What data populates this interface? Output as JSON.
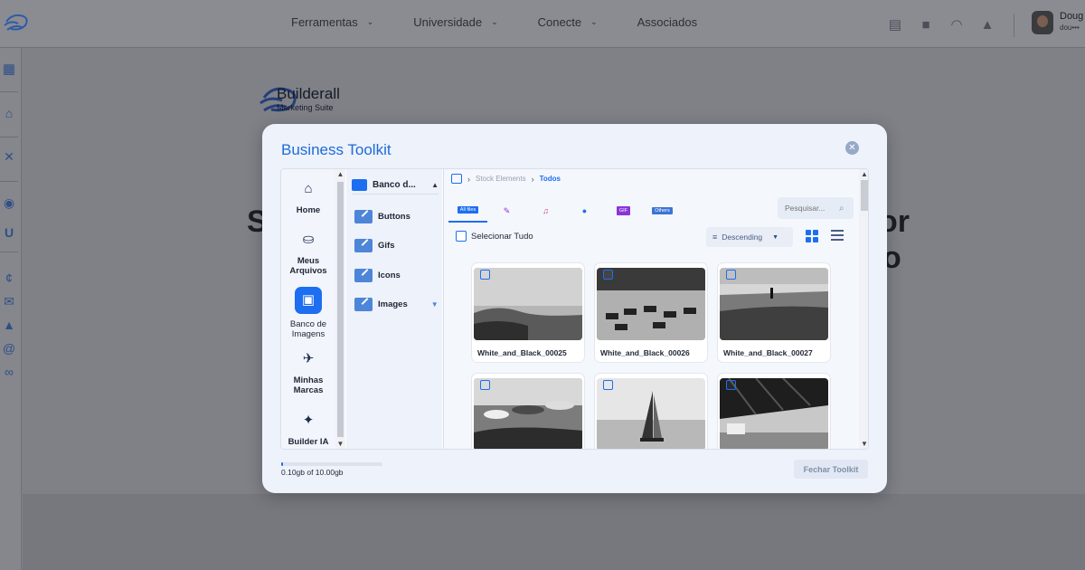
{
  "topbar": {
    "nav": [
      {
        "label": "Ferramentas",
        "has_dropdown": true
      },
      {
        "label": "Universidade",
        "has_dropdown": true
      },
      {
        "label": "Conecte",
        "has_dropdown": true
      },
      {
        "label": "Associados",
        "has_dropdown": false
      }
    ],
    "icons": [
      "book-icon",
      "video-icon",
      "headset-icon",
      "bell-icon"
    ],
    "user": {
      "name": "Doug",
      "email": "dou•••"
    }
  },
  "background": {
    "brand_name": "Builderall",
    "brand_sub": "Marketing Suite",
    "headline_left": "S",
    "headline_right": "or",
    "headline_right2": "o"
  },
  "modal": {
    "title": "Business Toolkit",
    "close_icon": "close-icon",
    "nav": [
      {
        "label": "Home",
        "icon": "home-icon"
      },
      {
        "label": "Meus Arquivos",
        "icon": "drive-icon"
      },
      {
        "label": "Banco de Imagens",
        "icon": "images-icon",
        "active": true
      },
      {
        "label": "Minhas Marcas",
        "icon": "rocket-icon"
      },
      {
        "label": "Builder IA",
        "icon": "magic-wand-icon"
      }
    ],
    "folders": {
      "header": "Banco d...",
      "items": [
        {
          "label": "Buttons"
        },
        {
          "label": "Gifs"
        },
        {
          "label": "Icons"
        },
        {
          "label": "Images",
          "expandable": true
        }
      ]
    },
    "breadcrumb": {
      "parent": "Stock Elements",
      "current": "Todos"
    },
    "tabs": [
      {
        "label": "All files",
        "icon": "all-files-icon",
        "active": true
      },
      {
        "label": "",
        "icon": "design-icon"
      },
      {
        "label": "",
        "icon": "music-icon"
      },
      {
        "label": "",
        "icon": "play-icon"
      },
      {
        "label": "GIF",
        "icon": "gif-icon"
      },
      {
        "label": "Others",
        "icon": "others-icon"
      }
    ],
    "search_placeholder": "Pesquisar...",
    "select_all": "Selecionar Tudo",
    "sort": "Descending",
    "cards": [
      {
        "name": "White_and_Black_00025"
      },
      {
        "name": "White_and_Black_00026"
      },
      {
        "name": "White_and_Black_00027"
      },
      {
        "name": ""
      },
      {
        "name": ""
      },
      {
        "name": ""
      }
    ],
    "storage": {
      "text": "0.10gb of 10.00gb",
      "used_fraction": 0.01
    },
    "close_button": "Fechar Toolkit"
  },
  "colors": {
    "accent": "#1d6ef0",
    "title": "#1e6bd6",
    "gif_badge": "#8b35d8"
  }
}
